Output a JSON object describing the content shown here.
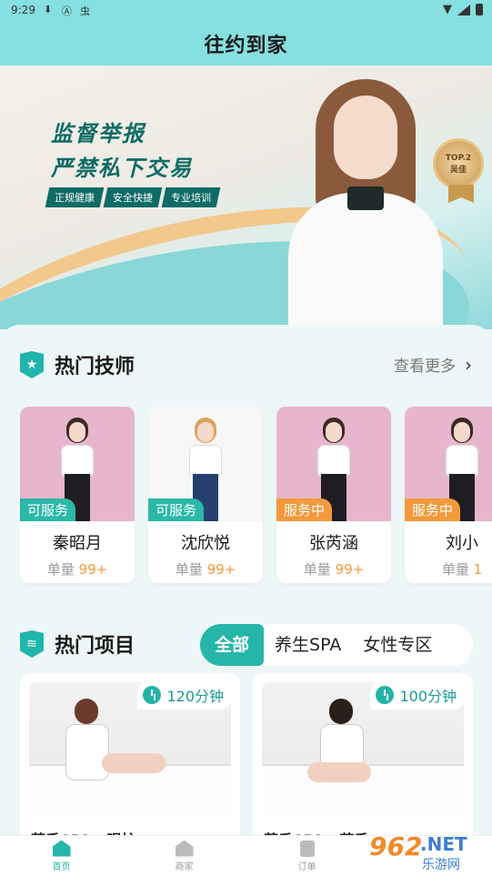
{
  "status_bar": {
    "time": "9:29",
    "icons": [
      "download-icon",
      "a-icon",
      "bug-icon"
    ],
    "right_icons": [
      "wifi-icon",
      "signal-icon",
      "battery-icon"
    ]
  },
  "header": {
    "title": "往约到家"
  },
  "banner": {
    "slogan_line1": "监督举报",
    "slogan_line2": "严禁私下交易",
    "tags": [
      "正规健康",
      "安全快捷",
      "专业培训"
    ],
    "badge_top": "TOP.2",
    "badge_bottom": "吴佳"
  },
  "hot_techs": {
    "title": "热门技师",
    "more_label": "查看更多",
    "items": [
      {
        "name": "秦昭月",
        "status": "可服务",
        "count_label": "单量",
        "count": "99+"
      },
      {
        "name": "沈欣悦",
        "status": "可服务",
        "count_label": "单量",
        "count": "99+"
      },
      {
        "name": "张芮涵",
        "status": "服务中",
        "count_label": "单量",
        "count": "99+"
      },
      {
        "name": "刘小",
        "status": "服务中",
        "count_label": "单量",
        "count": "1"
      }
    ]
  },
  "hot_projects": {
    "title": "热门项目",
    "tabs": [
      "全部",
      "养生SPA",
      "女性专区"
    ],
    "active_tab": "全部",
    "items": [
      {
        "duration": "120分钟",
        "title": "芙香SPA · 眼护"
      },
      {
        "duration": "100分钟",
        "title": "芙香SPA · 芬香"
      }
    ]
  },
  "bottom_nav": {
    "items": [
      {
        "label": "首页",
        "icon": "home-icon"
      },
      {
        "label": "商家",
        "icon": "shop-icon"
      },
      {
        "label": "订单",
        "icon": "order-icon"
      },
      {
        "label": "",
        "icon": ""
      }
    ]
  },
  "watermark": {
    "number": "962",
    "domain": ".NET",
    "site": "乐游网"
  },
  "colors": {
    "accent": "#26b6a9",
    "header_bg": "#86dfe0",
    "busy": "#f29a3b",
    "count": "#f29a3b"
  }
}
